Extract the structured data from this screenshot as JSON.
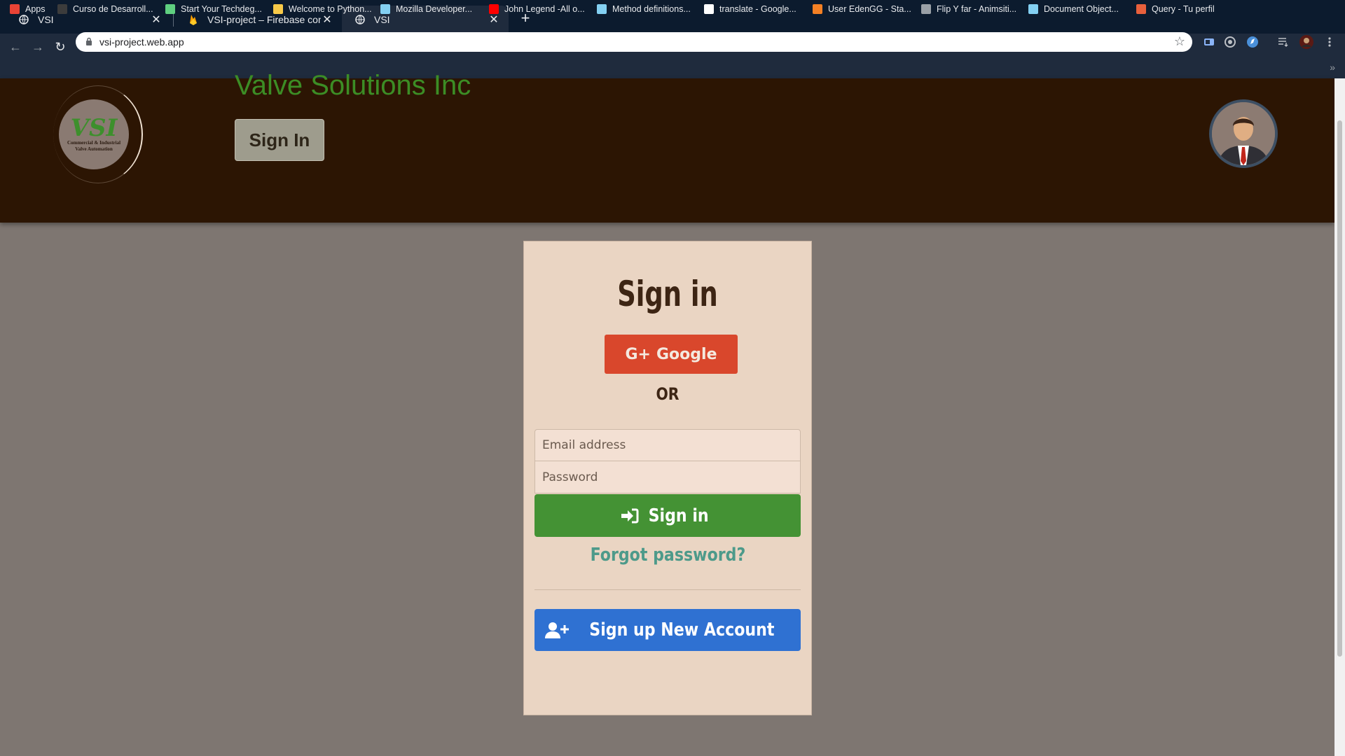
{
  "browser": {
    "tabs": [
      {
        "title": "VSI",
        "active": false
      },
      {
        "title": "VSI-project – Firebase console",
        "active": false
      },
      {
        "title": "VSI",
        "active": true
      }
    ],
    "url": "vsi-project.web.app",
    "bookmarks": [
      {
        "label": "Apps",
        "icon": "apps-grid-icon",
        "color": "#ea4335"
      },
      {
        "label": "Curso de Desarroll...",
        "icon": "course-icon",
        "color": "#3c3c3c"
      },
      {
        "label": "Start Your Techdeg...",
        "icon": "treehouse-icon",
        "color": "#5fcf80"
      },
      {
        "label": "Welcome to Python...",
        "icon": "python-icon",
        "color": "#f7c948"
      },
      {
        "label": "Mozilla Developer...",
        "icon": "mdn-icon",
        "color": "#83d0f2"
      },
      {
        "label": "John Legend -All o...",
        "icon": "youtube-icon",
        "color": "#ff0000"
      },
      {
        "label": "Method definitions...",
        "icon": "mdn-icon",
        "color": "#83d0f2"
      },
      {
        "label": "translate - Google...",
        "icon": "google-icon",
        "color": "#ffffff"
      },
      {
        "label": "User EdenGG - Sta...",
        "icon": "stackoverflow-icon",
        "color": "#f48024"
      },
      {
        "label": "Flip Y far - Animsiti...",
        "icon": "globe-icon",
        "color": "#9aa0a6"
      },
      {
        "label": "Document Object...",
        "icon": "mdn-icon",
        "color": "#83d0f2"
      },
      {
        "label": "Query - Tu perfil",
        "icon": "query-icon",
        "color": "#e8603c"
      }
    ]
  },
  "header": {
    "brand_title": "Valve Solutions Inc",
    "logo_mark": "VSI",
    "logo_sub_1": "Commercial & Industrial",
    "logo_sub_2": "Valve Automation",
    "signin_label": "Sign In",
    "colors": {
      "background": "#2c1503",
      "brand": "#3c8d25"
    }
  },
  "card": {
    "title": "Sign in",
    "google_label": "Google",
    "or_label": "OR",
    "email_placeholder": "Email address",
    "password_placeholder": "Password",
    "signin_label": "Sign in",
    "forgot_label": "Forgot password?",
    "signup_label": "Sign up New Account",
    "colors": {
      "google": "#d9472c",
      "signin": "#449234",
      "signup": "#2f71d2",
      "forgot": "#4d9a8a"
    }
  }
}
